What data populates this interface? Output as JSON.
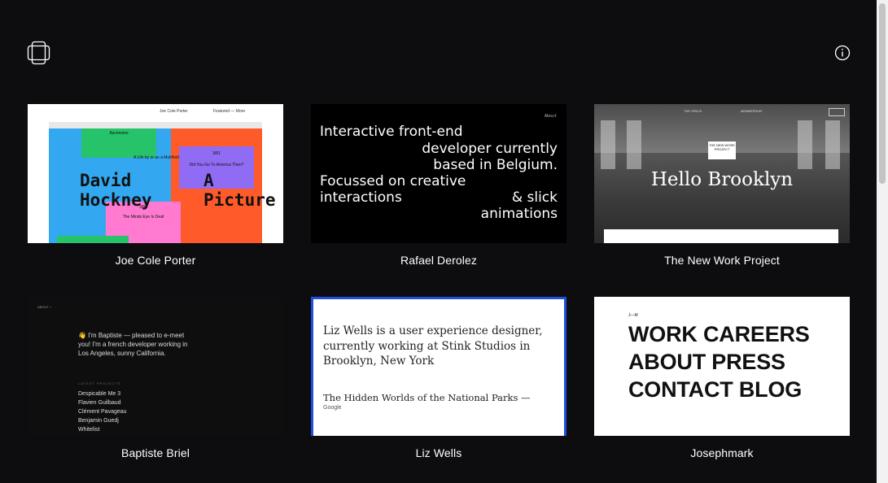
{
  "cards": [
    {
      "label": "Joe Cole Porter",
      "thumb": {
        "nav_name": "Joe Cole Porter",
        "nav_link": "Featured — More",
        "green_title": "Ascension",
        "purple_title": "Did You Go To America Then?",
        "purple_count": "3/81",
        "pink_title": "The Minds Eye Is Deaf",
        "big_left_1": "David",
        "big_left_2": "Hockney",
        "big_right_1": "A",
        "big_right_2": "Picture",
        "tagline": "A Life by or as a Multifold",
        "counter": "3/81"
      }
    },
    {
      "label": "Rafael Derolez",
      "thumb": {
        "about": "About",
        "lines": [
          "Interactive front-end",
          "developer currently",
          "based in Belgium.",
          "Focussed on creative",
          "interactions",
          "& slick",
          "animations"
        ]
      }
    },
    {
      "label": "The New Work Project",
      "thumb": {
        "nav_left": "THE SPACE",
        "nav_right": "MEMBERSHIP",
        "logo": "THE NEW WORK PROJECT",
        "headline": "Hello Brooklyn"
      }
    },
    {
      "label": "Baptiste Briel",
      "thumb": {
        "about": "ABOUT +",
        "intro": "👋 I'm Baptiste — pleased to e-meet you! I'm a french developer working in Los Angeles, sunny California.",
        "latest": "LATEST PROJECTS",
        "projects": [
          "Despicable Me 3",
          "Flavien Guilbaud",
          "Clément Pavageau",
          "Benjamin Guedj",
          "Whitelist"
        ]
      }
    },
    {
      "label": "Liz Wells",
      "thumb": {
        "intro": "Liz Wells is a user experience designer, currently working at Stink Studios in Brooklyn, New York",
        "project": "The Hidden Worlds of the National Parks —",
        "client": "Google"
      }
    },
    {
      "label": "Josephmark",
      "thumb": {
        "mark": "J—M",
        "lines": [
          "WORK CAREERS",
          "ABOUT PRESS",
          "CONTACT BLOG"
        ]
      }
    }
  ],
  "icons": {
    "logo": "stacked-frames-icon",
    "info": "info-icon"
  },
  "colors": {
    "background": "#0d0d0f",
    "liz_wells_border": "#1f4fdc"
  }
}
